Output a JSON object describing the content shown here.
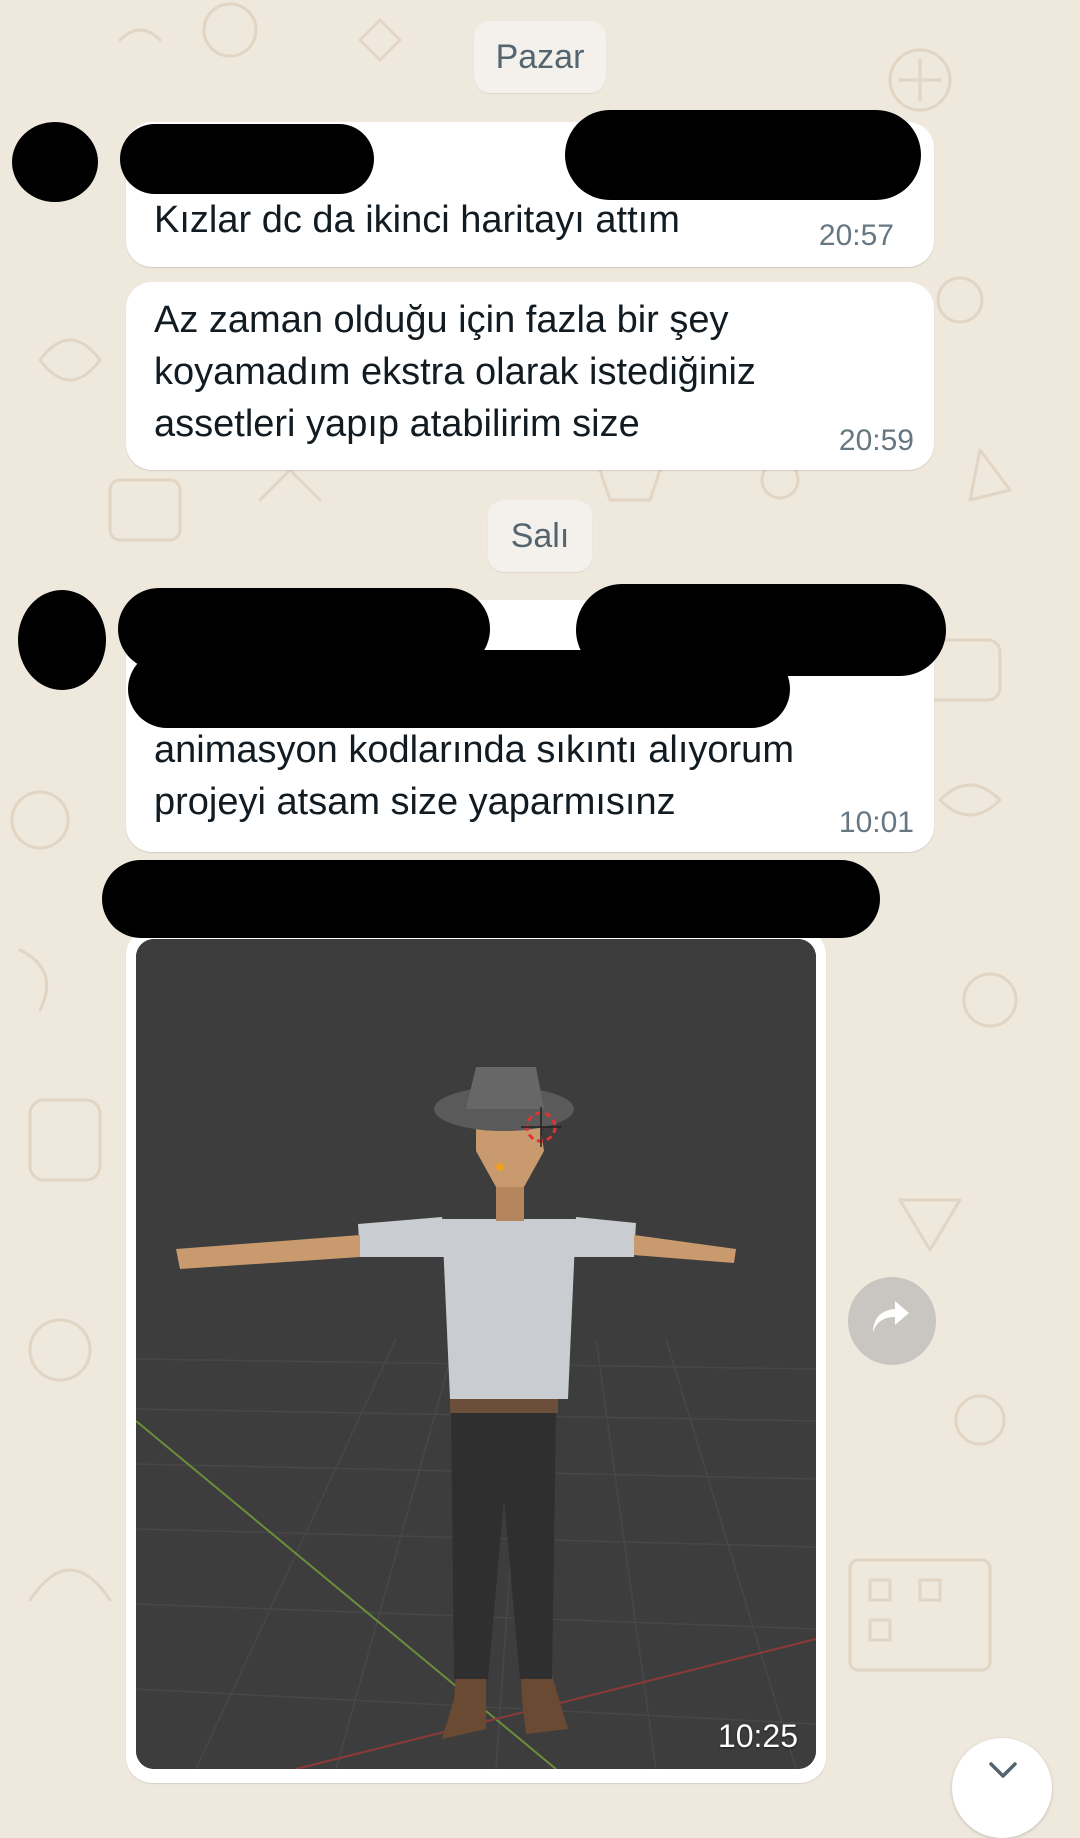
{
  "colors": {
    "background": "#efe8dd",
    "bubble": "#ffffff",
    "text": "#111b21",
    "timestamp": "#667781",
    "date_chip_bg": "#f4f1ed"
  },
  "dates": {
    "first": "Pazar",
    "second": "Salı"
  },
  "messages": [
    {
      "text": "Kızlar dc da ikinci haritayı attım",
      "time": "20:57"
    },
    {
      "text": "Az zaman olduğu için fazla bir şey\nkoyamadım ekstra olarak istediğiniz\nassetleri yapıp atabilirim size",
      "time": "20:59"
    },
    {
      "text": "animasyon kodlarında sıkıntı alıyorum\nprojeyi atsam size yaparmısınz",
      "time": "10:01"
    }
  ],
  "image_message": {
    "time": "10:25",
    "subject": "3d-character-t-pose"
  },
  "icons": {
    "forward": "forward-icon",
    "scroll_down": "chevron-down-icon"
  }
}
